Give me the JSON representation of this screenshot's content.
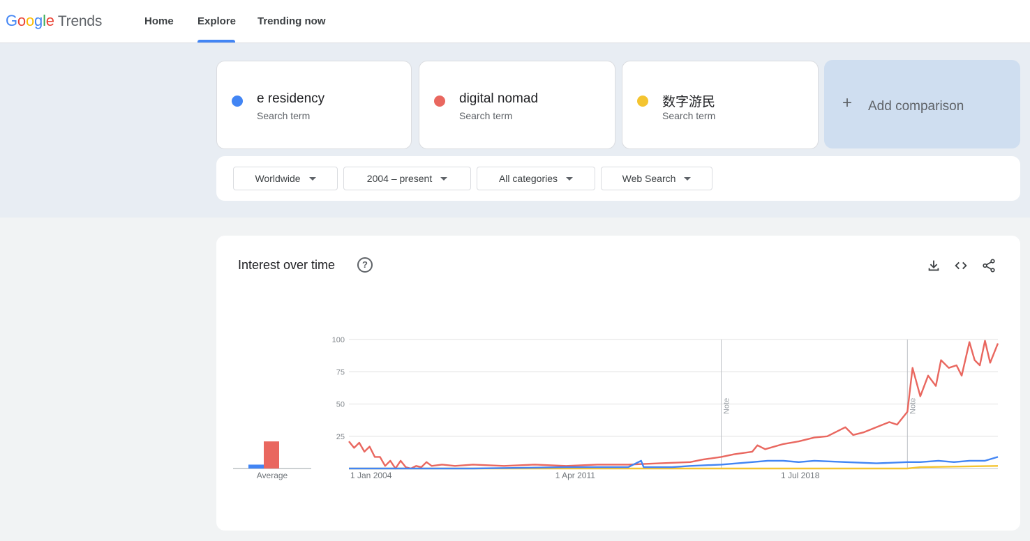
{
  "header": {
    "logo": {
      "word1": "Google",
      "word2": "Trends"
    },
    "nav": [
      {
        "label": "Home",
        "active": false
      },
      {
        "label": "Explore",
        "active": true
      },
      {
        "label": "Trending now",
        "active": false
      }
    ],
    "accent_color": "#4285f4"
  },
  "terms": [
    {
      "name": "e residency",
      "type": "Search term",
      "color": "#4285f4"
    },
    {
      "name": "digital nomad",
      "type": "Search term",
      "color": "#e9675f"
    },
    {
      "name": "数字游民",
      "type": "Search term",
      "color": "#f4c430"
    }
  ],
  "add_comparison": {
    "label": "Add comparison",
    "icon": "plus-icon"
  },
  "filters": [
    {
      "label": "Worldwide"
    },
    {
      "label": "2004 – present"
    },
    {
      "label": "All categories"
    },
    {
      "label": "Web Search"
    }
  ],
  "chart_panel": {
    "title": "Interest over time",
    "help_icon": "help-circle-icon",
    "toolbar_icons": [
      "download-icon",
      "embed-code-icon",
      "share-icon"
    ]
  },
  "chart_data": {
    "type": "line",
    "x_ticks": [
      "1 Jan 2004",
      "1 Apr 2011",
      "1 Jul 2018"
    ],
    "y_ticks": [
      25,
      50,
      75,
      100
    ],
    "ylim": [
      0,
      100
    ],
    "xlim": [
      "2004-01",
      "2024-12"
    ],
    "grid": true,
    "notes": [
      {
        "label": "Note",
        "x": "2016-01"
      },
      {
        "label": "Note",
        "x": "2022-01"
      }
    ],
    "average_label": "Average",
    "averages": [
      {
        "name": "e residency",
        "value": 3
      },
      {
        "name": "digital nomad",
        "value": 21
      },
      {
        "name": "数字游民",
        "value": 0
      }
    ],
    "series": [
      {
        "name": "e residency",
        "color": "#4285f4",
        "points": [
          [
            "2004-01",
            0
          ],
          [
            "2008-01",
            0
          ],
          [
            "2011-01",
            1
          ],
          [
            "2013-01",
            1
          ],
          [
            "2013-06",
            6
          ],
          [
            "2013-07",
            1
          ],
          [
            "2014-06",
            1
          ],
          [
            "2015-01",
            2
          ],
          [
            "2016-01",
            3
          ],
          [
            "2017-01",
            5
          ],
          [
            "2017-07",
            6
          ],
          [
            "2018-01",
            6
          ],
          [
            "2018-07",
            5
          ],
          [
            "2019-01",
            6
          ],
          [
            "2020-01",
            5
          ],
          [
            "2021-01",
            4
          ],
          [
            "2022-01",
            5
          ],
          [
            "2022-06",
            5
          ],
          [
            "2023-01",
            6
          ],
          [
            "2023-07",
            5
          ],
          [
            "2024-01",
            6
          ],
          [
            "2024-07",
            6
          ],
          [
            "2024-12",
            9
          ]
        ]
      },
      {
        "name": "digital nomad",
        "color": "#e9675f",
        "points": [
          [
            "2004-01",
            21
          ],
          [
            "2004-03",
            16
          ],
          [
            "2004-05",
            20
          ],
          [
            "2004-07",
            13
          ],
          [
            "2004-09",
            17
          ],
          [
            "2004-11",
            9
          ],
          [
            "2005-01",
            9
          ],
          [
            "2005-03",
            2
          ],
          [
            "2005-05",
            6
          ],
          [
            "2005-07",
            0
          ],
          [
            "2005-09",
            6
          ],
          [
            "2005-11",
            1
          ],
          [
            "2006-01",
            0
          ],
          [
            "2006-03",
            2
          ],
          [
            "2006-05",
            1
          ],
          [
            "2006-07",
            5
          ],
          [
            "2006-09",
            2
          ],
          [
            "2007-01",
            3
          ],
          [
            "2007-06",
            2
          ],
          [
            "2008-01",
            3
          ],
          [
            "2009-01",
            2
          ],
          [
            "2010-01",
            3
          ],
          [
            "2011-01",
            2
          ],
          [
            "2012-01",
            3
          ],
          [
            "2013-01",
            3
          ],
          [
            "2014-01",
            4
          ],
          [
            "2015-01",
            5
          ],
          [
            "2015-06",
            7
          ],
          [
            "2016-01",
            9
          ],
          [
            "2016-06",
            11
          ],
          [
            "2017-01",
            13
          ],
          [
            "2017-03",
            18
          ],
          [
            "2017-06",
            15
          ],
          [
            "2018-01",
            19
          ],
          [
            "2018-07",
            21
          ],
          [
            "2019-01",
            24
          ],
          [
            "2019-06",
            25
          ],
          [
            "2020-01",
            32
          ],
          [
            "2020-04",
            26
          ],
          [
            "2020-08",
            28
          ],
          [
            "2021-01",
            32
          ],
          [
            "2021-06",
            36
          ],
          [
            "2021-09",
            34
          ],
          [
            "2022-01",
            44
          ],
          [
            "2022-03",
            78
          ],
          [
            "2022-06",
            56
          ],
          [
            "2022-09",
            72
          ],
          [
            "2022-12",
            64
          ],
          [
            "2023-02",
            84
          ],
          [
            "2023-05",
            78
          ],
          [
            "2023-08",
            80
          ],
          [
            "2023-10",
            72
          ],
          [
            "2024-01",
            98
          ],
          [
            "2024-03",
            84
          ],
          [
            "2024-05",
            80
          ],
          [
            "2024-07",
            99
          ],
          [
            "2024-09",
            82
          ],
          [
            "2024-12",
            97
          ]
        ]
      },
      {
        "name": "数字游民",
        "color": "#f4c430",
        "points": [
          [
            "2004-01",
            0
          ],
          [
            "2022-01",
            0
          ],
          [
            "2022-06",
            1
          ],
          [
            "2024-12",
            2
          ]
        ]
      }
    ]
  }
}
